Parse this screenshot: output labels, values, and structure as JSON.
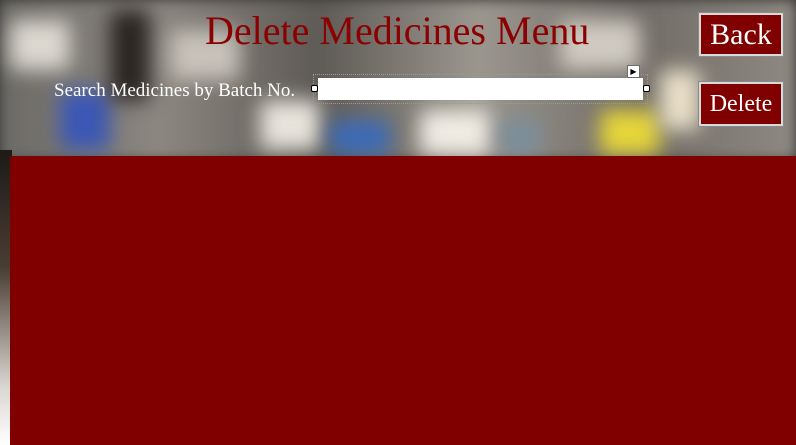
{
  "window": {
    "title": "Delete Medicines Menu"
  },
  "buttons": {
    "back_label": "Back",
    "delete_label": "Delete"
  },
  "search": {
    "label": "Search Medicines by Batch No.",
    "value": "",
    "placeholder": ""
  },
  "icons": {
    "smart_tag": "smart-tag-arrow-icon"
  },
  "colors": {
    "title": "#8b0000",
    "button_bg": "#800000",
    "panel_bg": "#800000",
    "label_text": "#ffffff"
  }
}
